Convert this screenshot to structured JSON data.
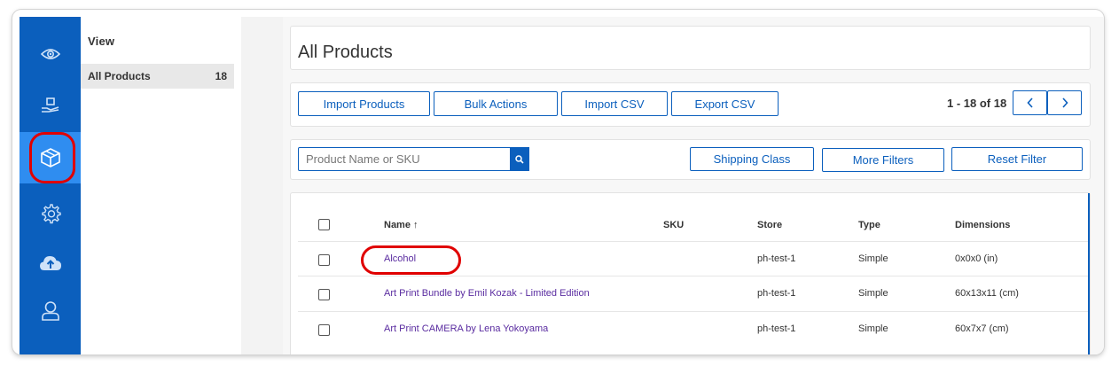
{
  "sidebar": {
    "items": [
      {
        "icon": "eye-icon",
        "active": false
      },
      {
        "icon": "hand-box-icon",
        "active": false
      },
      {
        "icon": "cube-icon",
        "active": true
      },
      {
        "icon": "gear-icon",
        "active": false
      },
      {
        "icon": "cloud-upload-icon",
        "active": false
      },
      {
        "icon": "user-icon",
        "active": false
      }
    ]
  },
  "view_panel": {
    "title": "View",
    "items": [
      {
        "label": "All Products",
        "count": "18"
      }
    ]
  },
  "header": {
    "title": "All Products"
  },
  "toolbar": {
    "import_products": "Import Products",
    "bulk_actions": "Bulk Actions",
    "import_csv": "Import CSV",
    "export_csv": "Export CSV",
    "pager": "1 - 18 of 18"
  },
  "filters": {
    "search_placeholder": "Product Name or SKU",
    "shipping_class": "Shipping Class",
    "more_filters": "More Filters",
    "reset_filter": "Reset Filter"
  },
  "table": {
    "columns": {
      "name": "Name ↑",
      "sku": "SKU",
      "store": "Store",
      "type": "Type",
      "dimensions": "Dimensions"
    },
    "rows": [
      {
        "name": "Alcohol",
        "sku": "",
        "store": "ph-test-1",
        "type": "Simple",
        "dimensions": "0x0x0 (in)"
      },
      {
        "name": "Art Print Bundle by Emil Kozak - Limited Edition",
        "sku": "",
        "store": "ph-test-1",
        "type": "Simple",
        "dimensions": "60x13x11 (cm)"
      },
      {
        "name": "Art Print CAMERA by Lena Yokoyama",
        "sku": "",
        "store": "ph-test-1",
        "type": "Simple",
        "dimensions": "60x7x7 (cm)"
      }
    ]
  },
  "colors": {
    "brand": "#0b5fbd",
    "active_rail": "#2f8df0",
    "highlight": "#e00000",
    "link": "#5a2ca0"
  }
}
